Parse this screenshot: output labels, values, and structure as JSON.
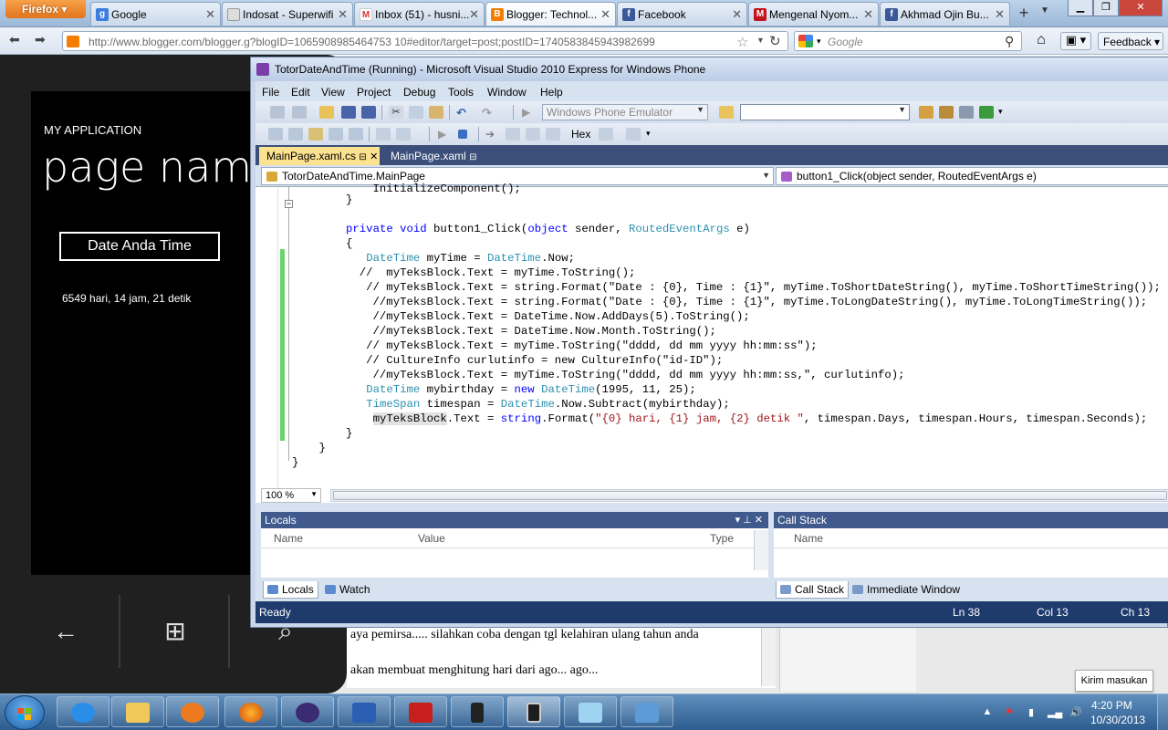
{
  "firefox": {
    "menu_button": "Firefox",
    "tabs": [
      {
        "label": "Google",
        "fav_letter": "g"
      },
      {
        "label": "Indosat - Superwifi",
        "fav_letter": ""
      },
      {
        "label": "Inbox (51) - husni...",
        "fav_letter": "M"
      },
      {
        "label": "Blogger: Technol...",
        "fav_letter": "B"
      },
      {
        "label": "Facebook",
        "fav_letter": "f"
      },
      {
        "label": "Mengenal Nyom...",
        "fav_letter": "M"
      },
      {
        "label": "Akhmad Ojin Bu...",
        "fav_letter": "f"
      }
    ],
    "new_tab": "+",
    "url": "http://www.blogger.com/blogger.g?blogID=1065908985464753 10#editor/target=post;postID=1740583845943982699",
    "search_placeholder": "Google",
    "feedback_label": "Feedback"
  },
  "blog": {
    "line1": "aya pemirsa..... silahkan coba dengan tgl kelahiran ulang tahun anda",
    "line2": "akan membuat menghitung hari dari ago... ago...",
    "send_feedback": "Kirim masukan"
  },
  "phone": {
    "app_name": "MY APPLICATION",
    "page_name": "page name",
    "button_label": "Date Anda Time",
    "result_text": "6549 hari, 14 jam, 21 detik",
    "keys": [
      "←",
      "⊞",
      "⌕"
    ]
  },
  "vs": {
    "title": "TotorDateAndTime (Running) - Microsoft Visual Studio 2010 Express for Windows Phone",
    "menu": [
      "File",
      "Edit",
      "View",
      "Project",
      "Debug",
      "Tools",
      "Window",
      "Help"
    ],
    "target_combo": "Windows Phone Emulator",
    "hex_label": "Hex",
    "doc_tabs": [
      "MainPage.xaml.cs",
      "MainPage.xaml"
    ],
    "class_combo": "TotorDateAndTime.MainPage",
    "member_combo": "button1_Click(object sender, RoutedEventArgs e)",
    "zoom": "100 %",
    "locals": {
      "title": "Locals",
      "columns": [
        "Name",
        "Value",
        "Type"
      ]
    },
    "callstack": {
      "title": "Call Stack",
      "columns": [
        "Name"
      ]
    },
    "left_tabs": [
      "Locals",
      "Watch"
    ],
    "right_tabs": [
      "Call Stack",
      "Immediate Window"
    ],
    "status": {
      "ready": "Ready",
      "ln": "Ln 38",
      "col": "Col 13",
      "ch": "Ch 13"
    }
  },
  "taskbar": {
    "time": "4:20 PM",
    "date": "10/30/2013"
  }
}
